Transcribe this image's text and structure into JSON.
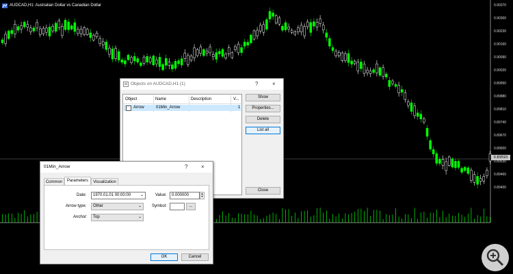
{
  "chart": {
    "title": "AUDCAD,H1:  Australian Dollar vs Canadian Dollar",
    "price_labels": [
      "0.90370",
      "0.90300",
      "0.90230",
      "0.90160",
      "0.90090",
      "0.90020",
      "0.89950",
      "0.89880",
      "0.89810",
      "0.89740",
      "0.89670",
      "0.89600",
      "0.89530",
      "0.89460",
      "0.89400"
    ],
    "current_price": "0.89593",
    "colors": {
      "bull": "#00ff00",
      "bear": "#ffffff",
      "background": "#000000",
      "volume": "#00ff00"
    }
  },
  "objects_dialog": {
    "title": "Objects on AUDCAD,H1 (1)",
    "help": "?",
    "close": "×",
    "columns": [
      "Object",
      "Name",
      "Description",
      "V..."
    ],
    "rows": [
      {
        "object": "Arrow",
        "name": "01Min_Arrow",
        "description": "",
        "v": "1"
      }
    ],
    "buttons": {
      "show": "Show",
      "properties": "Properties...",
      "delete": "Delete",
      "list_all": "List all",
      "close": "Close"
    }
  },
  "props_dialog": {
    "title": "01Min_Arrow",
    "help": "?",
    "close": "×",
    "tabs": [
      "Common",
      "Parameters",
      "Visualization"
    ],
    "active_tab": "Parameters",
    "date_label": "Date:",
    "date_value": "1970.01.01 00:00:00",
    "value_label": "Value:",
    "value_value": "0.000000",
    "arrow_type_label": "Arrow type:",
    "arrow_type_value": "Other",
    "symbol_label": "Symbol:",
    "symbol_button": "...",
    "anchor_label": "Anchor:",
    "anchor_value": "Top",
    "ok": "OK",
    "cancel": "Cancel"
  }
}
